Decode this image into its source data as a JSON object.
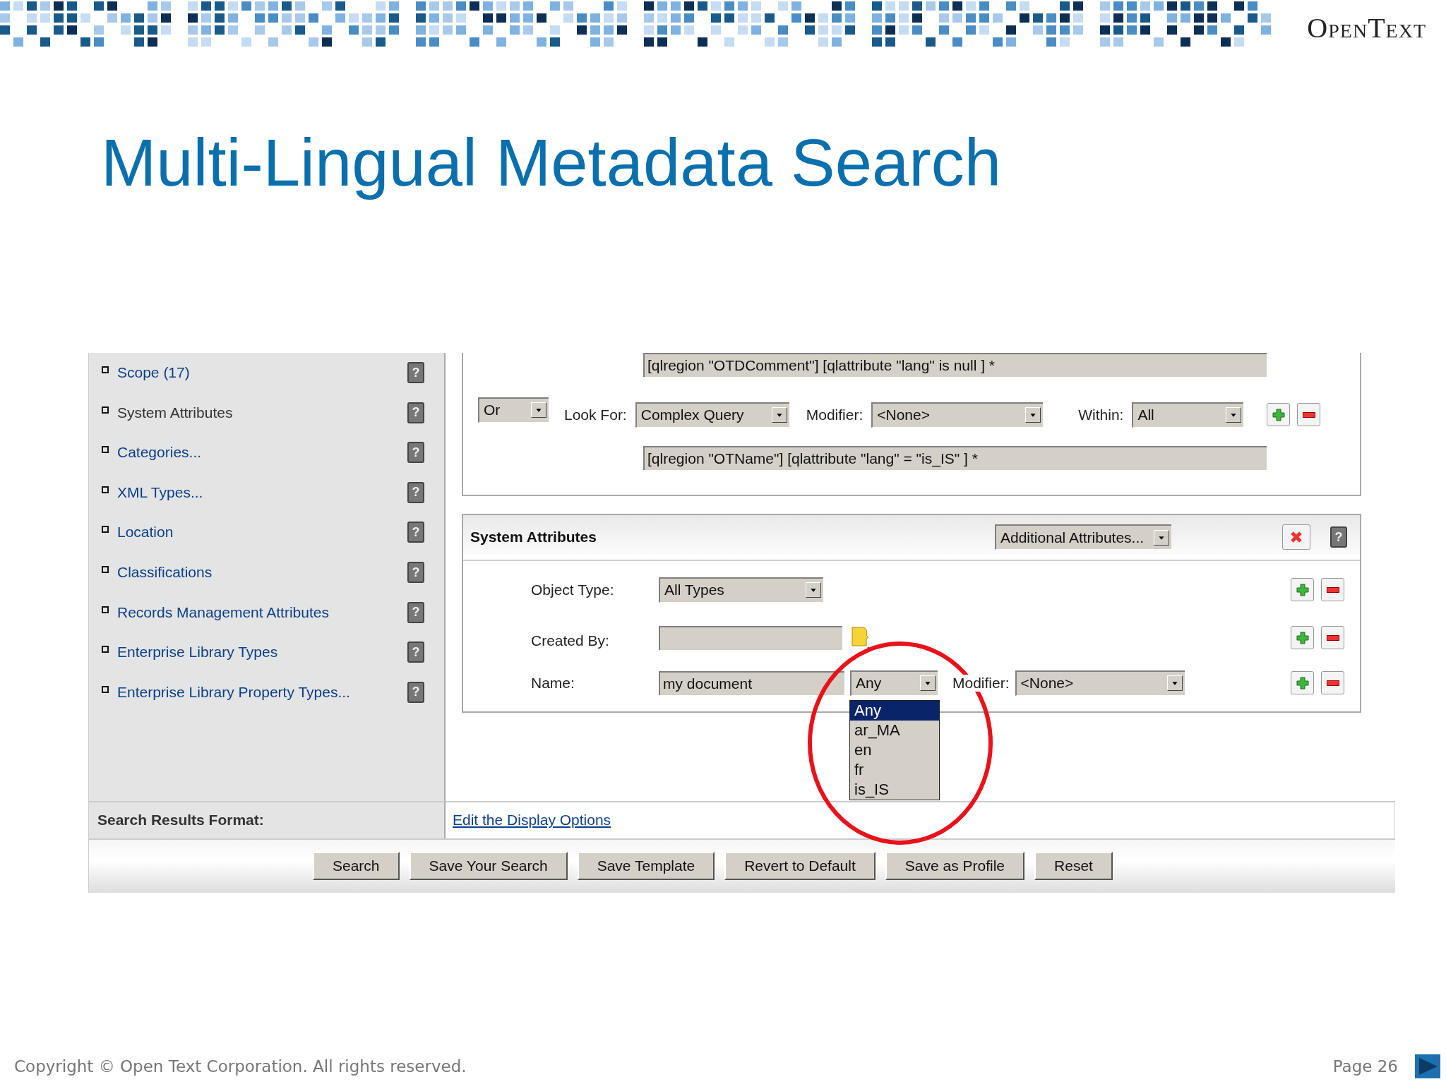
{
  "logo": "OpenText",
  "title": "Multi-Lingual Metadata Search",
  "help_glyph": "?",
  "sidebar": {
    "items": [
      {
        "label": "Scope (17)",
        "kind": "link"
      },
      {
        "label": "System Attributes",
        "kind": "plain"
      },
      {
        "label": "Categories...",
        "kind": "link"
      },
      {
        "label": "XML Types...",
        "kind": "link"
      },
      {
        "label": "Location",
        "kind": "link"
      },
      {
        "label": "Classifications",
        "kind": "link"
      },
      {
        "label": "Records Management Attributes",
        "kind": "link"
      },
      {
        "label": "Enterprise Library Types",
        "kind": "link"
      },
      {
        "label": "Enterprise Library Property Types...",
        "kind": "link"
      }
    ]
  },
  "query": {
    "previous_field": "[qlregion \"OTDComment\"] [qlattribute \"lang\" is null ] *",
    "operator": "Or",
    "look_for_label": "Look For:",
    "look_for": "Complex Query",
    "modifier_label": "Modifier:",
    "modifier": "<None>",
    "within_label": "Within:",
    "within": "All",
    "field": "[qlregion \"OTName\"] [qlattribute \"lang\" = \"is_IS\" ] *"
  },
  "system_attributes": {
    "title": "System Attributes",
    "additional": "Additional Attributes...",
    "object_type_label": "Object Type:",
    "object_type": "All Types",
    "created_by_label": "Created By:",
    "name_label": "Name:",
    "name_value": "my document",
    "language": "Any",
    "modifier_label": "Modifier:",
    "modifier": "<None>",
    "language_options": [
      {
        "label": "Any",
        "selected": true
      },
      {
        "label": "ar_MA",
        "selected": false
      },
      {
        "label": "en",
        "selected": false
      },
      {
        "label": "fr",
        "selected": false
      },
      {
        "label": "is_IS",
        "selected": false
      }
    ]
  },
  "results_format": {
    "label": "Search Results Format:",
    "link": "Edit the Display Options"
  },
  "buttons": [
    "Search",
    "Save Your Search",
    "Save Template",
    "Revert to Default",
    "Save as Profile",
    "Reset"
  ],
  "footer": {
    "copyright": "Copyright © Open Text Corporation. All rights reserved.",
    "page": "Page 26"
  }
}
